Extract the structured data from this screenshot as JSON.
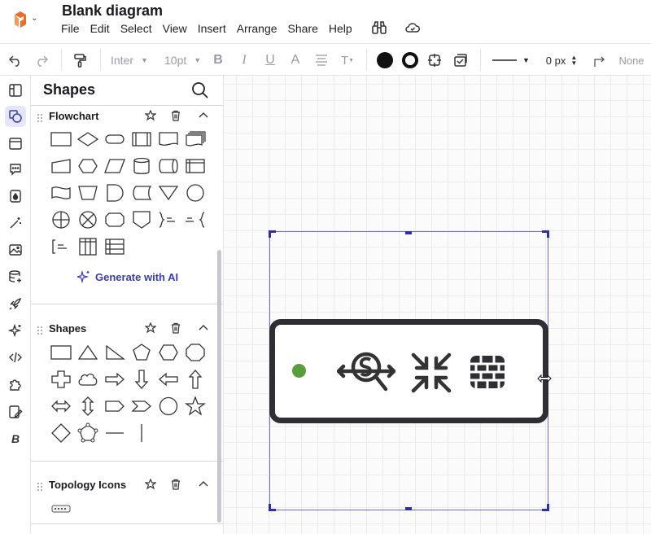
{
  "header": {
    "title": "Blank diagram",
    "menu": [
      "File",
      "Edit",
      "Select",
      "View",
      "Insert",
      "Arrange",
      "Share",
      "Help"
    ]
  },
  "toolbar": {
    "font": "Inter",
    "font_size": "10pt",
    "line_width": "0 px",
    "arrow_style": "None"
  },
  "sidebar": {
    "title": "Shapes",
    "sections": [
      {
        "name": "Flowchart"
      },
      {
        "name": "Shapes"
      },
      {
        "name": "Topology Icons"
      }
    ],
    "generate_ai_label": "Generate with AI"
  },
  "colors": {
    "accent": "#3b3bb5",
    "selection": "#2e2eaa",
    "status_dot": "#5a9e3a",
    "widget_border": "#2f2f33"
  },
  "canvas": {
    "widget_icons": [
      "status-dot",
      "network-scan-icon",
      "collapse-arrows-icon",
      "firewall-brick-icon"
    ]
  }
}
